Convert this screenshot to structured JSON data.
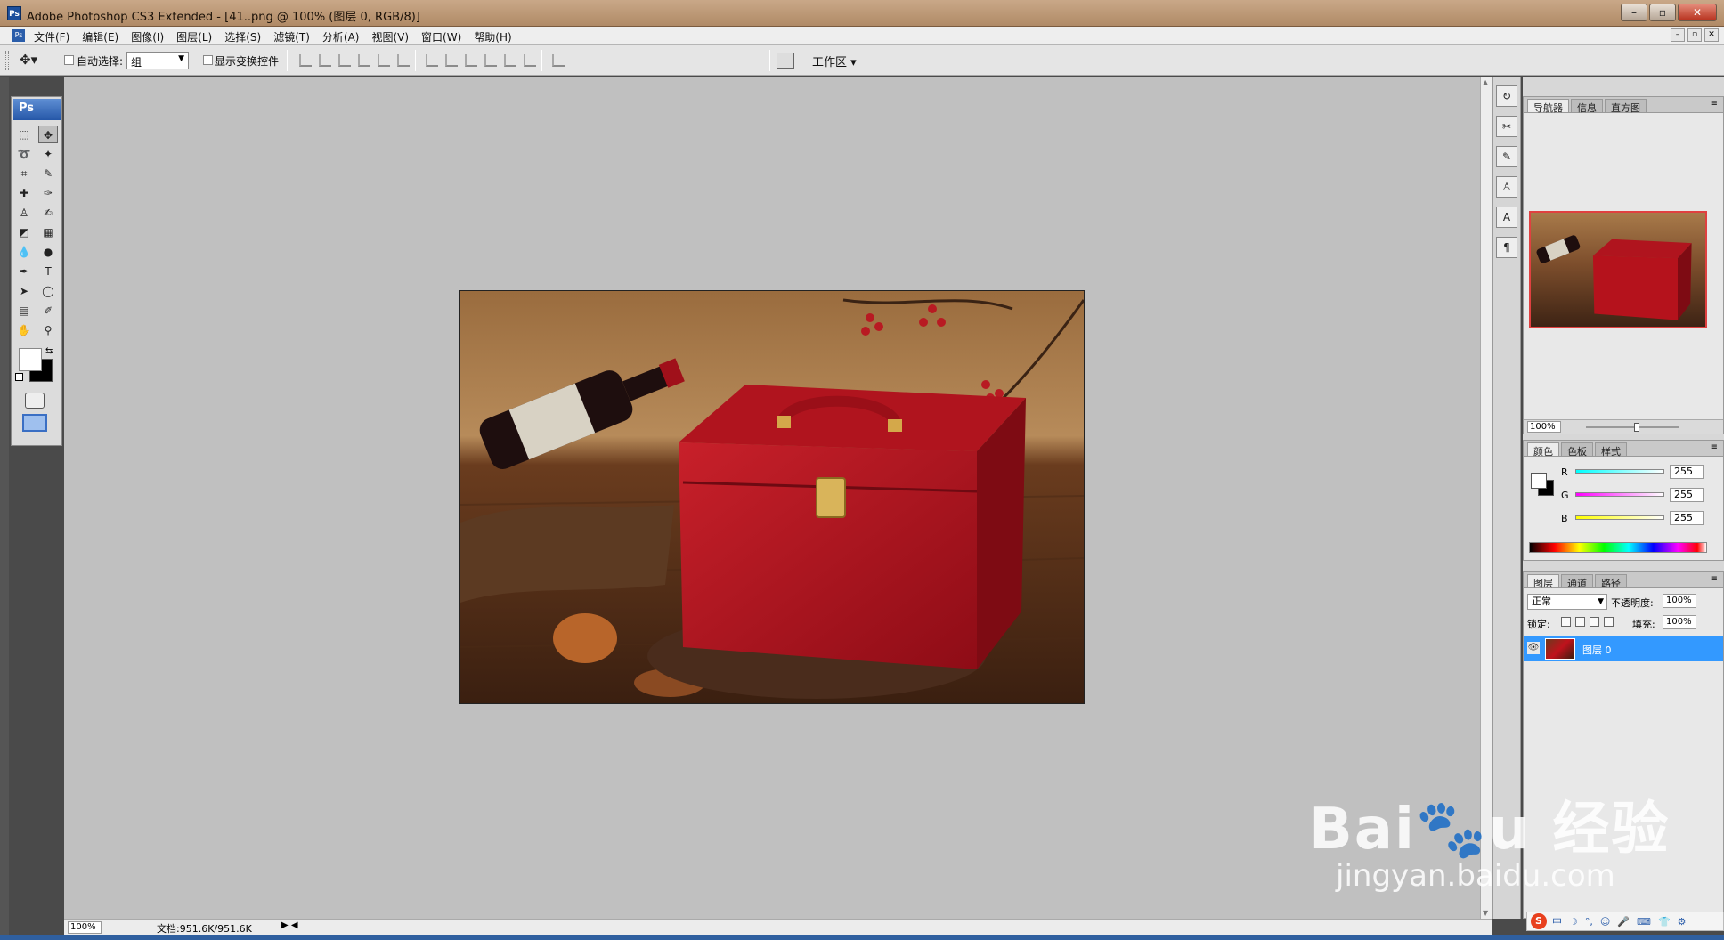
{
  "window": {
    "title": "Adobe Photoshop CS3 Extended - [41..png @ 100% (图层 0, RGB/8)]",
    "logo_text": "Ps"
  },
  "menu": [
    "文件(F)",
    "编辑(E)",
    "图像(I)",
    "图层(L)",
    "选择(S)",
    "滤镜(T)",
    "分析(A)",
    "视图(V)",
    "窗口(W)",
    "帮助(H)"
  ],
  "options_bar": {
    "auto_select_label": "自动选择:",
    "auto_select_value": "组",
    "show_transform_label": "显示变换控件",
    "workspace_label": "工作区 ▾"
  },
  "toolbox": {
    "header": "Ps",
    "tools": [
      "marquee-icon",
      "move-icon",
      "lasso-icon",
      "magic-wand-icon",
      "crop-icon",
      "slice-icon",
      "healing-icon",
      "brush-icon",
      "stamp-icon",
      "history-brush-icon",
      "eraser-icon",
      "gradient-icon",
      "blur-icon",
      "dodge-icon",
      "pen-icon",
      "text-icon",
      "path-select-icon",
      "shape-icon",
      "notes-icon",
      "eyedropper-icon",
      "hand-icon",
      "zoom-icon"
    ],
    "text_tool_glyph": "T",
    "foreground_color": "#ffffff",
    "background_color": "#000000"
  },
  "status_bar": {
    "zoom": "100%",
    "doc_info": "文档:951.6K/951.6K"
  },
  "navigator": {
    "tabs": [
      "导航器",
      "信息",
      "直方图"
    ],
    "zoom": "100%"
  },
  "color_panel": {
    "tabs": [
      "颜色",
      "色板",
      "样式"
    ],
    "channels": [
      {
        "name": "R",
        "value": "255"
      },
      {
        "name": "G",
        "value": "255"
      },
      {
        "name": "B",
        "value": "255"
      }
    ]
  },
  "layers_panel": {
    "tabs": [
      "图层",
      "通道",
      "路径"
    ],
    "blend_mode": "正常",
    "opacity_label": "不透明度:",
    "opacity": "100%",
    "lock_label": "锁定:",
    "fill_label": "填充:",
    "fill": "100%",
    "layers": [
      {
        "name": "图层 0"
      }
    ]
  },
  "watermark": {
    "brand": "Bai🐾u 经验",
    "url": "jingyan.baidu.com"
  },
  "ime": {
    "items": [
      "中",
      "☽",
      "°,",
      "☺",
      "🎤",
      "⌨",
      "👕",
      "⚙"
    ]
  }
}
